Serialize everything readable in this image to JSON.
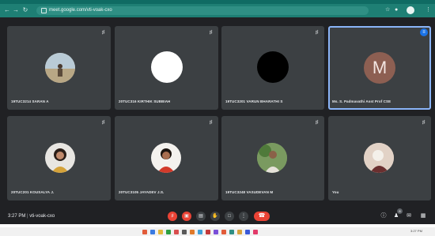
{
  "browser": {
    "url": "meet.google.com/vti-voak-cxo",
    "nav_icons": [
      "back-icon",
      "forward-icon",
      "reload-icon"
    ]
  },
  "tiles": [
    {
      "name": "19TUC3214 SARAN A",
      "muted": true,
      "avatar": "photo-person-outdoor"
    },
    {
      "name": "20TUC316 KIRTHIK SUBBIAH",
      "muted": true,
      "avatar": "white-circle"
    },
    {
      "name": "19TUC3201 VARUN BHARATHI S",
      "muted": true,
      "avatar": "black-circle"
    },
    {
      "name": "Ms. S. Padmavathi Asst Prof CSE",
      "muted": false,
      "speaking": true,
      "avatar": "letter",
      "letter": "M"
    },
    {
      "name": "20TUC201 KOUSALYA J.",
      "muted": true,
      "avatar": "photo-woman"
    },
    {
      "name": "20TUC3105 JAYADEV J.S.",
      "muted": true,
      "avatar": "photo-man-red-shirt"
    },
    {
      "name": "19TUC3248 VASUDEVAN M",
      "muted": true,
      "avatar": "photo-man-outdoor"
    },
    {
      "name": "You",
      "muted": true,
      "avatar": "photo-you"
    }
  ],
  "footer": {
    "time": "3:27 PM",
    "meeting_code": "vti-voak-cxo",
    "participants_count": "8"
  },
  "taskbar": {
    "time": "3:27 PM"
  },
  "colors": {
    "accent_red": "#ea4335",
    "chrome_teal": "#1e7f74",
    "tile_bg": "#3c4043",
    "speaking_blue": "#1a73e8"
  }
}
